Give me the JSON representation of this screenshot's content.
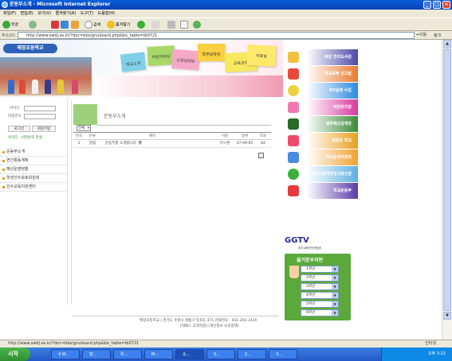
{
  "window": {
    "title": "운동부소개 - Microsoft Internet Explorer"
  },
  "menubar": [
    "파일(F)",
    "편집(E)",
    "보기(V)",
    "즐겨찾기(A)",
    "도구(T)",
    "도움말(H)"
  ],
  "toolbar": {
    "back_label": "뒤로",
    "search_label": "검색",
    "favorites_label": "즐겨찾기"
  },
  "address": {
    "label": "주소(D)",
    "url": "http://www.swdj.es.kr/?doc=bbs/gnuboard.php&bo_table=tb0721",
    "go_label": "이동",
    "links_label": "링크"
  },
  "site": {
    "logo": "매장초등학교"
  },
  "nav_tabs": [
    "학교소개",
    "어린이마당",
    "선생님마당",
    "학부모마당",
    "교육과정",
    "자료실"
  ],
  "login": {
    "id_label": "아이디",
    "pw_label": "비밀번호",
    "login_button": "로그인",
    "join_button": "회원가입",
    "find_link": "아이디 · 비밀번호 분실"
  },
  "sidemenu": [
    "운동부소개",
    "연간활동계획",
    "예산운영현황",
    "학생선수보호위원회",
    "선수교육지원센터"
  ],
  "board": {
    "title": "운동부소개",
    "category": "전체",
    "columns": [
      "번호",
      "분류",
      "제목",
      "이름",
      "날짜",
      "조회"
    ],
    "rows": [
      {
        "num": "1",
        "cat": "알림",
        "title": "운동부를 소개합니다. 鷺",
        "name": "이ㅇ환",
        "date": "07-09-05",
        "hits": "64"
      }
    ]
  },
  "footer": {
    "line1": "매장초등학교 | 경기도 수원시 영통구 망포동 371 전화번호 : 031-204-1430",
    "line2": "[대배스 고객지원] [개인정보 보호정책]"
  },
  "right_menu": [
    {
      "label": "매장 전자도서관",
      "color": "#4a4aa8"
    },
    {
      "label": "학교폭력 신고함",
      "color": "#e87a2e"
    },
    {
      "label": "주5일제 수업",
      "color": "#2e8ae0"
    },
    {
      "label": "매장유치원",
      "color": "#d83aa0"
    },
    {
      "label": "영투예산공개방",
      "color": "#3a8a3a"
    },
    {
      "label": "배움은 학교",
      "color": "#e8a020"
    },
    {
      "label": "학교운영위원회",
      "color": "#f0a030"
    },
    {
      "label": "학교시설개방및사용신청",
      "color": "#5ab0e0"
    },
    {
      "label": "학교운동부",
      "color": "#5a3aa8"
    }
  ],
  "ggtv": {
    "label": "GGTV",
    "sub": "경기교육인터넷방송"
  },
  "grades": {
    "title": "즐거운우리반",
    "options": [
      "1학년",
      "2학년",
      "3학년",
      "4학년",
      "5학년",
      "6학년"
    ]
  },
  "statusbar": {
    "url": "http://www.swdj.es.kr/?doc=bbs/gnuboard.php&bo_table=tb0721",
    "zone": "인터넷"
  },
  "taskbar": {
    "start": "시작",
    "tasks": [
      "4 W...",
      "말...",
      "위...",
      "M...",
      "숏...",
      "S...",
      "2...",
      "3..."
    ],
    "clock": "오후 3:22"
  }
}
